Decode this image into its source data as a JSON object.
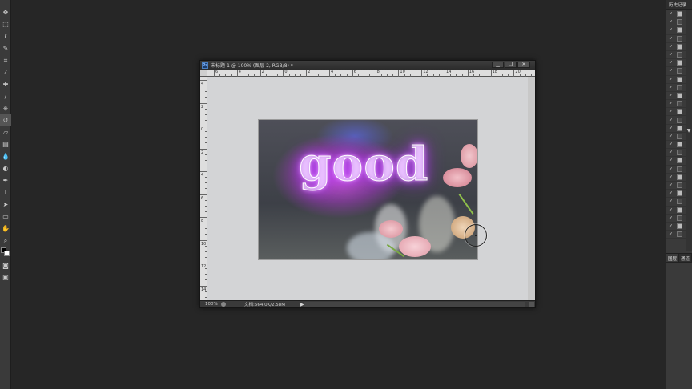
{
  "document": {
    "title": "未标题-1 @ 100% (图层 2, RGB/8) *",
    "app_badge": "Ps",
    "minimize": "▁",
    "restore": "❐",
    "close": "✕",
    "canvas_text": "good",
    "zoom": "100%",
    "doc_info": "文档:564.0K/2.58M",
    "status_arrow": "▶",
    "ruler_h_labels": [
      "6",
      "4",
      "2",
      "0",
      "2",
      "4",
      "6",
      "8",
      "10",
      "12",
      "14",
      "16",
      "18",
      "20"
    ],
    "ruler_v_labels": [
      "4",
      "2",
      "0",
      "2",
      "4",
      "6",
      "8",
      "10",
      "12",
      "14"
    ]
  },
  "toolbar": {
    "tools": [
      "move",
      "marquee",
      "lasso",
      "quick-select",
      "crop",
      "eyedropper",
      "healing",
      "brush",
      "stamp",
      "history-brush",
      "eraser",
      "gradient",
      "blur",
      "dodge",
      "pen",
      "type",
      "path-select",
      "shape",
      "hand",
      "zoom"
    ],
    "glyphs": [
      "✥",
      "⬚",
      "ℓ",
      "✎",
      "⌗",
      "⁄",
      "✚",
      "/",
      "⎈",
      "↺",
      "▱",
      "▤",
      "💧",
      "◐",
      "✒",
      "T",
      "➤",
      "▭",
      "✋",
      "⌕"
    ],
    "active_index": 9
  },
  "history_panel": {
    "tab_label": "历史记录",
    "row_count": 28
  },
  "lower_panel": {
    "tabs": [
      "图层",
      "通道"
    ]
  },
  "colors": {
    "workspace": "#262626",
    "panel": "#3a3a3a",
    "glow": "#c050ff"
  }
}
